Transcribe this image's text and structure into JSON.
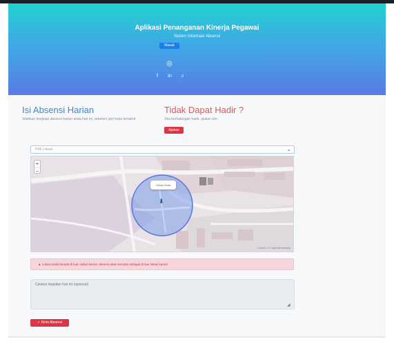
{
  "header": {
    "title": "Aplikasi Penanganan Kinerja Pegawai",
    "subtitle": "Sistem Informasi Absensi",
    "badge": "Masuk",
    "icon_instagram": "instagram-icon",
    "social_icons": [
      "facebook-icon",
      "linkedin-icon",
      "twitter-icon"
    ],
    "social_glyphs": [
      "f",
      "in",
      "♫"
    ]
  },
  "left_panel": {
    "title": "Isi Absensi Harian",
    "description": "Silahkan lengkapi absensi harian anda hari ini, sebelum jam kerja berakhir"
  },
  "right_panel": {
    "title": "Tidak Dapat Hadir ?",
    "description": "Jika berhalangan hadir, ajukan izin",
    "button_label": "Ajukan"
  },
  "location_select": {
    "selected": "Pilih Lokasi"
  },
  "map": {
    "zoom_in": "+",
    "zoom_out": "−",
    "popup_text": "Lokasi Anda",
    "attribution": "Leaflet | © OpenStreetMap"
  },
  "alert": {
    "text": "▲ Lokasi anda berada di luar radius kantor, absensi akan tercatat sebagai di luar lokasi kantor"
  },
  "notes": {
    "placeholder": "Catatan kegiatan hari ini (opsional)"
  },
  "submit": {
    "label": "✓ Kirim Absensi"
  },
  "colors": {
    "hero_top": "#21d2cf",
    "hero_bottom": "#5a7be6",
    "primary_blue": "#3f86c4",
    "danger_red": "#dc3545",
    "alert_bg": "#f6d6dc"
  }
}
